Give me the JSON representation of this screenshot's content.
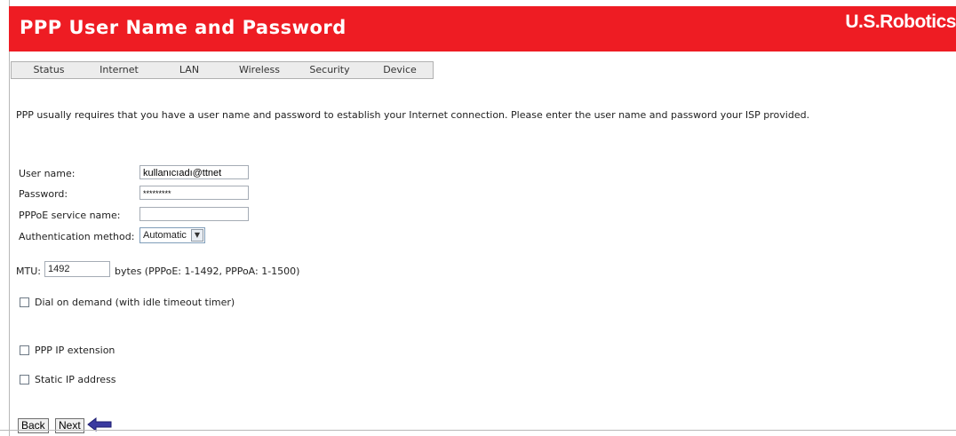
{
  "header": {
    "title": "PPP User Name and Password",
    "brand": "U.S.Robotics"
  },
  "tabs": [
    {
      "label": "Status"
    },
    {
      "label": "Internet"
    },
    {
      "label": "LAN"
    },
    {
      "label": "Wireless"
    },
    {
      "label": "Security"
    },
    {
      "label": "Device"
    }
  ],
  "intro": "PPP usually requires that you have a user name and password to establish your Internet connection. Please enter the user name and password your ISP provided.",
  "form": {
    "username_label": "User name:",
    "username_value": "kullanıcıadı@ttnet",
    "password_label": "Password:",
    "password_value": "*********",
    "service_label": "PPPoE service name:",
    "service_value": "",
    "auth_label": "Authentication method:",
    "auth_value": "Automatic",
    "mtu_label": "MTU:",
    "mtu_value": "1492",
    "mtu_hint": "bytes (PPPoE: 1-1492, PPPoA: 1-1500)"
  },
  "options": {
    "dial_on_demand": "Dial on demand (with idle timeout timer)",
    "ppp_ip_extension": "PPP IP extension",
    "static_ip": "Static IP address"
  },
  "buttons": {
    "back": "Back",
    "next": "Next"
  },
  "colors": {
    "header_bg": "#ee1c23",
    "arrow": "#3a3aa0"
  }
}
